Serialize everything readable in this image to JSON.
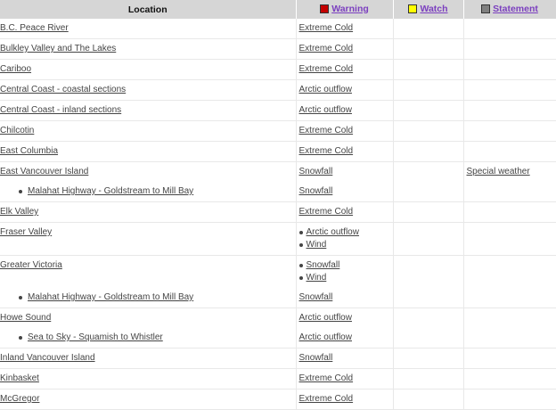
{
  "header": {
    "location": "Location",
    "warning": "Warning",
    "watch": "Watch",
    "statement": "Statement"
  },
  "colors": {
    "warning": "#c40000",
    "watch": "#ffff00",
    "statement": "#808080",
    "header_bg": "#d6d6d6",
    "header_link": "#7b3fbf"
  },
  "rows": [
    {
      "location": "B.C. Peace River",
      "warning": "Extreme Cold"
    },
    {
      "location": "Bulkley Valley and The Lakes",
      "warning": "Extreme Cold"
    },
    {
      "location": "Cariboo",
      "warning": "Extreme Cold"
    },
    {
      "location": "Central Coast - coastal sections",
      "warning": "Arctic outflow"
    },
    {
      "location": "Central Coast - inland sections",
      "warning": "Arctic outflow"
    },
    {
      "location": "Chilcotin",
      "warning": "Extreme Cold"
    },
    {
      "location": "East Columbia",
      "warning": "Extreme Cold"
    },
    {
      "location": "East Vancouver Island",
      "warning": "Snowfall",
      "statement": "Special weather"
    },
    {
      "location": "Malahat Highway - Goldstream to Mill Bay",
      "warning": "Snowfall"
    },
    {
      "location": "Elk Valley",
      "warning": "Extreme Cold"
    },
    {
      "location": "Fraser Valley",
      "warnings": [
        "Arctic outflow",
        "Wind"
      ]
    },
    {
      "location": "Greater Victoria",
      "warnings": [
        "Snowfall",
        "Wind"
      ]
    },
    {
      "location": "Malahat Highway - Goldstream to Mill Bay",
      "warning": "Snowfall"
    },
    {
      "location": "Howe Sound",
      "warning": "Arctic outflow"
    },
    {
      "location": "Sea to Sky - Squamish to Whistler",
      "warning": "Arctic outflow"
    },
    {
      "location": "Inland Vancouver Island",
      "warning": "Snowfall"
    },
    {
      "location": "Kinbasket",
      "warning": "Extreme Cold"
    },
    {
      "location": "McGregor",
      "warning": "Extreme Cold"
    }
  ]
}
